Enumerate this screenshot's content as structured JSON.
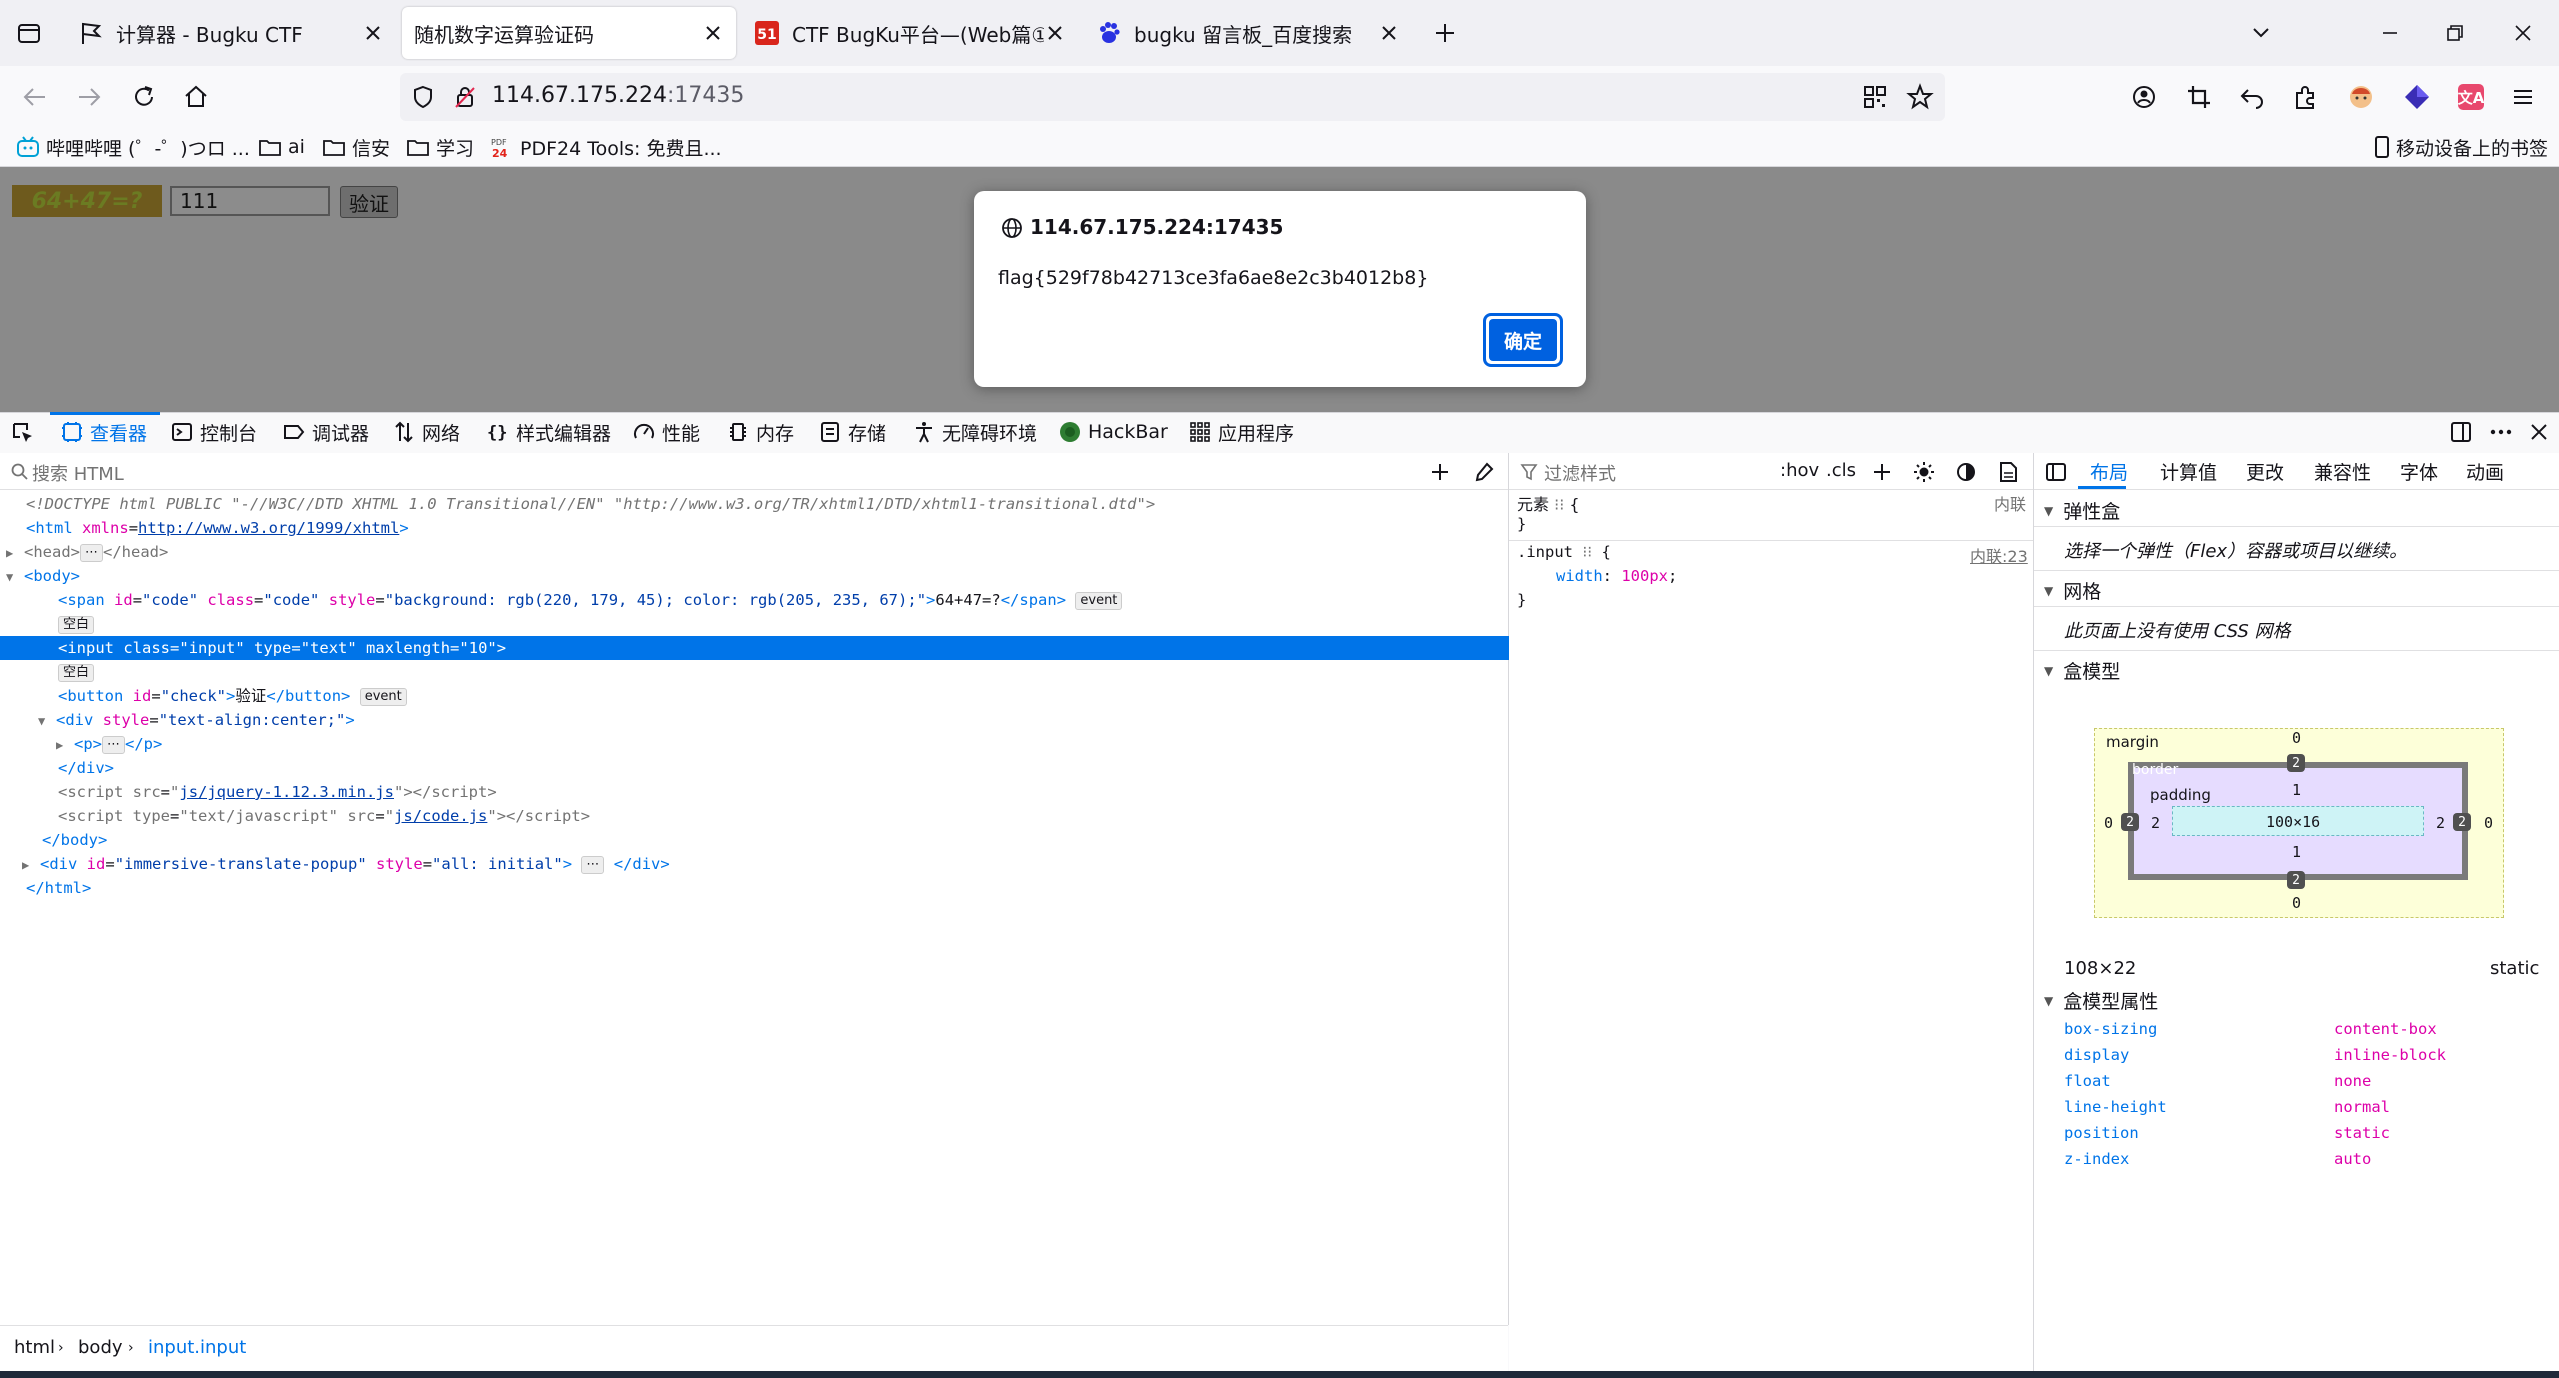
{
  "tabs": [
    {
      "title": "计算器 - Bugku CTF",
      "active": false
    },
    {
      "title": "随机数字运算验证码",
      "active": true
    },
    {
      "title": "CTF BugKu平台—(Web篇①)",
      "active": false
    },
    {
      "title": "bugku 留言板_百度搜索",
      "active": false
    }
  ],
  "url": {
    "host": "114.67.175.224",
    "port": ":17435"
  },
  "bookmarks": [
    {
      "label": "哔哩哔哩 (゜-゜)つロ ..."
    },
    {
      "label": "ai"
    },
    {
      "label": "信安"
    },
    {
      "label": "学习"
    },
    {
      "label": "PDF24 Tools: 免费且..."
    },
    {
      "label": "移动设备上的书签"
    }
  ],
  "page": {
    "captcha": "64+47=?",
    "answer_value": "111",
    "check_label": "验证"
  },
  "dialog": {
    "origin": "114.67.175.224:17435",
    "message": "flag{529f78b42713ce3fa6ae8e2c3b4012b8}",
    "ok_label": "确定"
  },
  "devtools": {
    "tabs": [
      "查看器",
      "控制台",
      "调试器",
      "网络",
      "样式编辑器",
      "性能",
      "内存",
      "存储",
      "无障碍环境",
      "HackBar",
      "应用程序"
    ],
    "search_placeholder": "搜索 HTML",
    "markup": {
      "doctype": "<!DOCTYPE html PUBLIC \"-//W3C//DTD XHTML 1.0 Transitional//EN\" \"http://www.w3.org/TR/xhtml1/DTD/xhtml1-transitional.dtd\">",
      "html_xmlns": "http://www.w3.org/1999/xhtml",
      "span_style": "background: rgb(220, 179, 45); color: rgb(205, 235, 67);",
      "span_text": "64+47=?",
      "event_badge": "event",
      "whitespace_badge": "空白",
      "input_maxlength": "10",
      "button_text": "验证",
      "div_style": "text-align:center;",
      "script1_src": "js/jquery-1.12.3.min.js",
      "script2_type": "text/javascript",
      "script2_src": "js/code.js",
      "popup_id": "immersive-translate-popup",
      "popup_style": "all: initial"
    },
    "breadcrumbs": [
      "html",
      "body",
      "input.input"
    ],
    "rules": {
      "filter_placeholder": "过滤样式",
      "hov": ":hov",
      "cls": ".cls",
      "element_label": "元素",
      "inline_label": "内联",
      "rule_selector": ".input",
      "rule_source": "内联:23",
      "rule_prop": "width",
      "rule_value": "100px"
    },
    "layout": {
      "tabs": [
        "布局",
        "计算值",
        "更改",
        "兼容性",
        "字体",
        "动画"
      ],
      "flex_head": "弹性盒",
      "flex_msg": "选择一个弹性（Flex）容器或项目以继续。",
      "grid_head": "网格",
      "grid_msg": "此页面上没有使用 CSS 网格",
      "box_head": "盒模型",
      "box": {
        "margin_label": "margin",
        "border_label": "border",
        "padding_label": "padding",
        "margin": [
          "0",
          "0",
          "0",
          "0"
        ],
        "border": [
          "2",
          "2",
          "2",
          "2"
        ],
        "padding": [
          "1",
          "2",
          "1",
          "2"
        ],
        "content": "100×16"
      },
      "size": "108×22",
      "position": "static",
      "props_head": "盒模型属性",
      "props": [
        {
          "k": "box-sizing",
          "v": "content-box"
        },
        {
          "k": "display",
          "v": "inline-block"
        },
        {
          "k": "float",
          "v": "none"
        },
        {
          "k": "line-height",
          "v": "normal"
        },
        {
          "k": "position",
          "v": "static"
        },
        {
          "k": "z-index",
          "v": "auto"
        }
      ]
    }
  }
}
